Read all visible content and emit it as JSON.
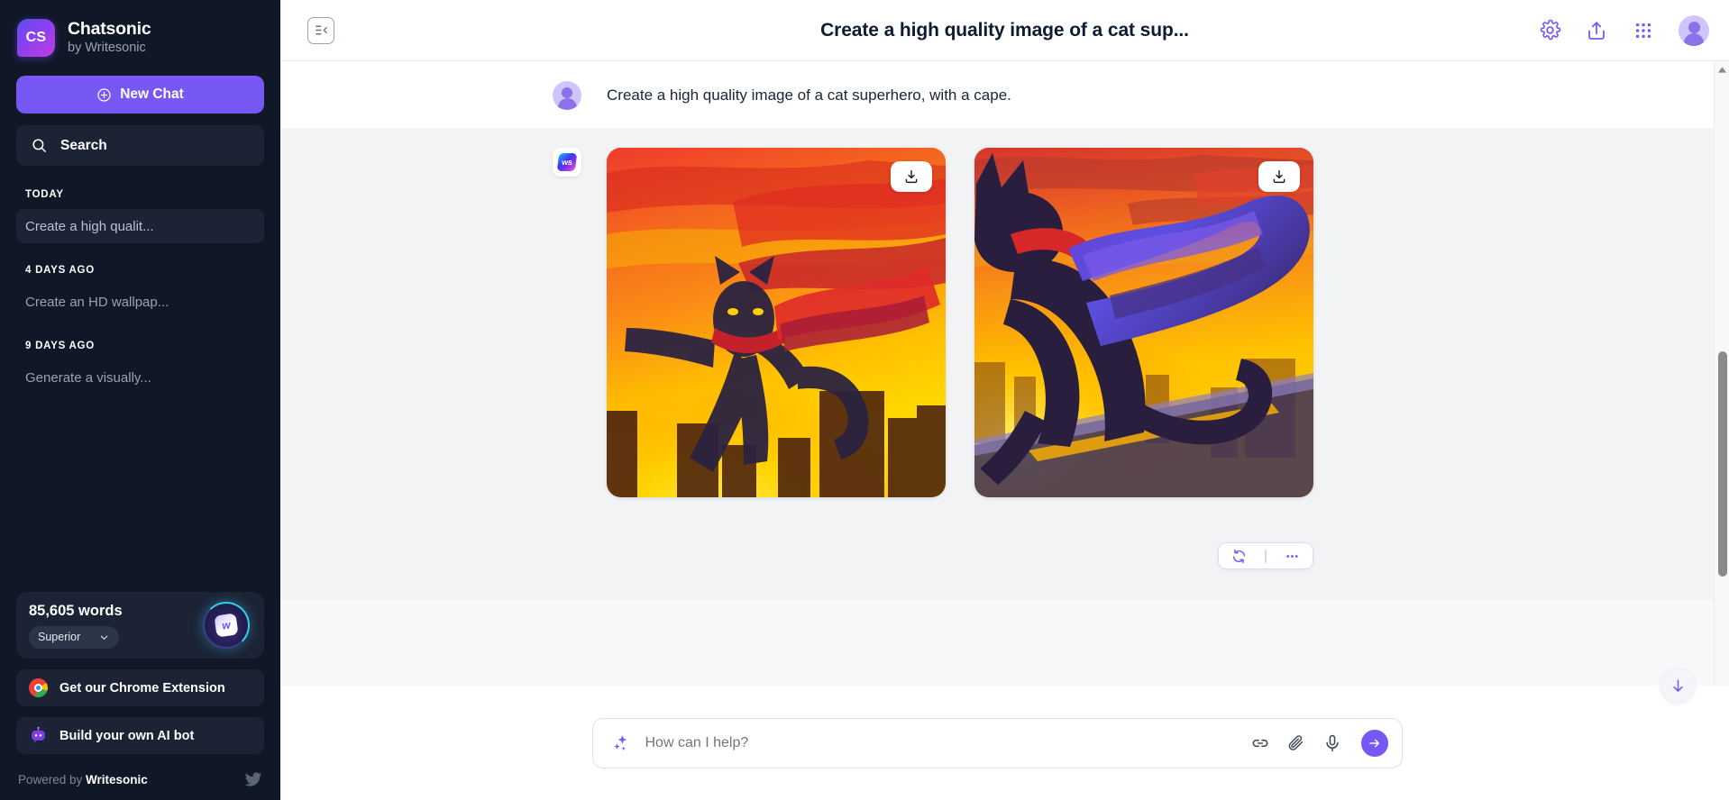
{
  "sidebar": {
    "brand": {
      "logo_text": "CS",
      "name": "Chatsonic",
      "subtitle": "by Writesonic"
    },
    "new_chat_label": "New Chat",
    "search_label": "Search",
    "history_groups": [
      {
        "label": "TODAY",
        "items": [
          {
            "title": "Create a high qualit...",
            "active": true
          }
        ]
      },
      {
        "label": "4 DAYS AGO",
        "items": [
          {
            "title": "Create an HD wallpap...",
            "active": false
          }
        ]
      },
      {
        "label": "9 DAYS AGO",
        "items": [
          {
            "title": "Generate a visually...",
            "active": false
          }
        ]
      }
    ],
    "words": {
      "count_label": "85,605 words",
      "plan_label": "Superior",
      "orb_letter": "w"
    },
    "chrome_extension_label": "Get our Chrome Extension",
    "build_bot_label": "Build your own AI bot",
    "powered_prefix": "Powered by ",
    "powered_brand": "Writesonic"
  },
  "topbar": {
    "title": "Create a high quality image of a cat sup...",
    "collapse_icon": "sidebar-collapse-icon",
    "icons": [
      "gear-icon",
      "share-icon",
      "apps-grid-icon"
    ],
    "avatar": "user-avatar"
  },
  "conversation": {
    "user_message": {
      "avatar": "user-avatar",
      "text": "Create a high quality image of a cat superhero, with a cape."
    },
    "bot_message": {
      "avatar_text": "ws",
      "images": [
        {
          "alt": "Cat superhero with red cape leaping over a burning orange city skyline",
          "download_label": "download-icon"
        },
        {
          "alt": "Black cat superhero with purple cape on a rooftop at sunset over a golden city",
          "download_label": "download-icon"
        }
      ],
      "actions": [
        "regenerate-icon",
        "more-options-icon"
      ]
    }
  },
  "composer": {
    "sparkle_icon": "sparkle-icon",
    "placeholder": "How can I help?",
    "icons": [
      "link-icon",
      "attachment-icon",
      "microphone-icon"
    ],
    "send_icon": "send-arrow-icon"
  },
  "scroll": {
    "down_label": "scroll-to-bottom"
  },
  "colors": {
    "accent": "#7758f5",
    "sidebar_bg": "#101828",
    "sidebar_card": "#1b2334",
    "bot_row_bg": "#f2f3f5",
    "title_color": "#0d1b33"
  }
}
